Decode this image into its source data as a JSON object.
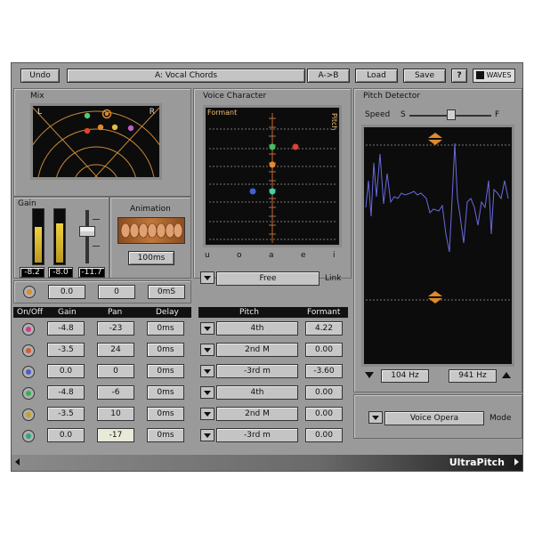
{
  "toolbar": {
    "undo": "Undo",
    "preset": "A: Vocal Chords",
    "ab": "A->B",
    "load": "Load",
    "save": "Save",
    "help": "?",
    "brand": "WAVES"
  },
  "mix": {
    "title": "Mix",
    "left": "L",
    "right": "R"
  },
  "gain": {
    "title": "Gain",
    "readouts": [
      "-8.2",
      "-8.0",
      "-11.7"
    ],
    "meter_levels": [
      0.62,
      0.7
    ]
  },
  "animation": {
    "title": "Animation",
    "value": "100ms"
  },
  "voice_character": {
    "title": "Voice Character",
    "formant": "Formant",
    "pitch": "Pitch",
    "vowels": [
      "u",
      "o",
      "a",
      "e",
      "i"
    ],
    "link_value": "Free",
    "link_label": "Link"
  },
  "pitch_detector": {
    "title": "Pitch Detector",
    "speed": "Speed",
    "slow": "S",
    "fast": "F",
    "low_hz": "104 Hz",
    "high_hz": "941 Hz"
  },
  "master": {
    "gain": "0.0",
    "pan": "0",
    "delay": "0mS"
  },
  "voice_table": {
    "headers": [
      "On/Off",
      "Gain",
      "Pan",
      "Delay"
    ],
    "pitch_headers": [
      "Pitch",
      "Formant"
    ],
    "rows": [
      {
        "led": "#d23a8a",
        "gain": "-4.8",
        "pan": "-23",
        "delay": "0ms",
        "pitch": "4th",
        "formant": "4.22"
      },
      {
        "led": "#d65a2c",
        "gain": "-3.5",
        "pan": "24",
        "delay": "0ms",
        "pitch": "2nd M",
        "formant": "0.00"
      },
      {
        "led": "#4a5ed0",
        "gain": "0.0",
        "pan": "0",
        "delay": "0ms",
        "pitch": "-3rd m",
        "formant": "-3.60"
      },
      {
        "led": "#35b050",
        "gain": "-4.8",
        "pan": "-6",
        "delay": "0ms",
        "pitch": "4th",
        "formant": "0.00"
      },
      {
        "led": "#c6a020",
        "gain": "-3.5",
        "pan": "10",
        "delay": "0ms",
        "pitch": "2nd M",
        "formant": "0.00"
      },
      {
        "led": "#2fa87a",
        "gain": "0.0",
        "pan": "-17",
        "delay": "0ms",
        "pitch": "-3rd m",
        "formant": "0.00"
      }
    ]
  },
  "mode": {
    "value": "Voice Opera",
    "label": "Mode"
  },
  "footer": {
    "product": "UltraPitch"
  }
}
